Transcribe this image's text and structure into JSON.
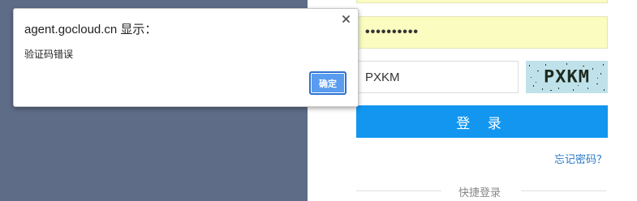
{
  "login_form": {
    "username_value": "",
    "password_value": "••••••••••",
    "captcha_input_value": "PXKM",
    "captcha_image_text": "PXKM",
    "login_button_label": "登 录",
    "forgot_password_link": "忘记密码？",
    "quick_login_label": "快捷登录"
  },
  "alert_dialog": {
    "title": "agent.gocloud.cn 显示：",
    "message": "验证码错误",
    "ok_button_label": "确定",
    "close_icon": "close-icon"
  },
  "colors": {
    "left_panel": "#5f6c88",
    "login_button": "#1296f0",
    "autofill_background": "#fafcc0",
    "link": "#2a79c8",
    "dialog_ok_button": "#5a9cf0"
  }
}
